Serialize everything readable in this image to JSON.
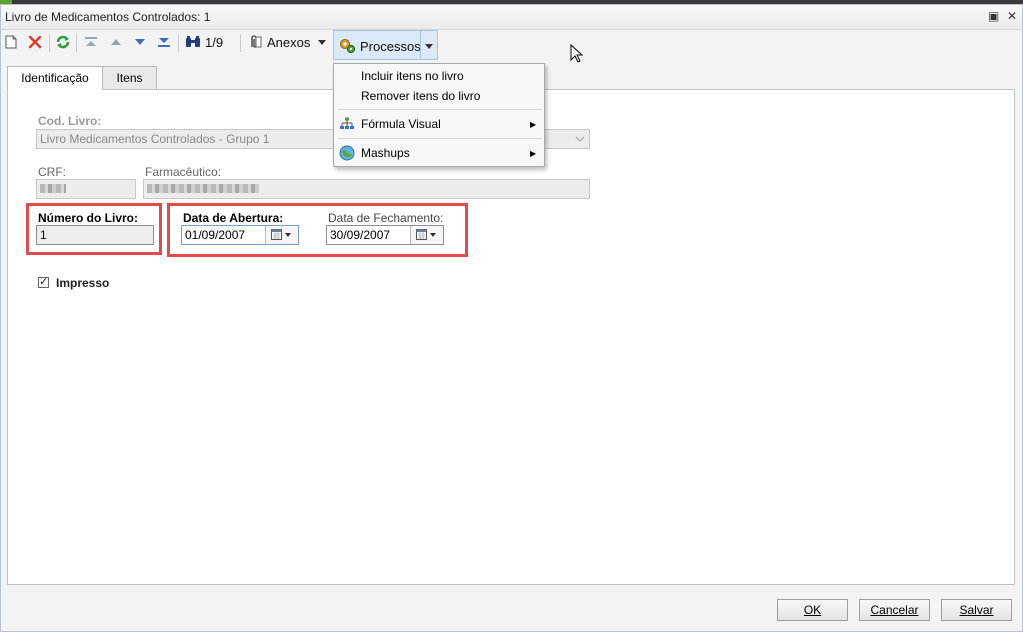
{
  "window": {
    "title": "Livro de Medicamentos Controlados: 1",
    "restore_glyph": "▣",
    "close_glyph": "✕"
  },
  "toolbar": {
    "record_counter": "1/9",
    "anexos_label": "Anexos",
    "processos_label": "Processos",
    "icons": [
      "new-icon",
      "delete-icon",
      "refresh-icon",
      "first-icon",
      "previous-icon",
      "next-icon",
      "last-icon",
      "search-icon",
      "paperclip-icon",
      "gears-icon"
    ]
  },
  "tabs": [
    {
      "label": "Identificação",
      "active": true
    },
    {
      "label": "Itens",
      "active": false
    }
  ],
  "form": {
    "cod_livro_label": "Cod. Livro:",
    "cod_livro_value": "Livro Medicamentos Controlados - Grupo 1",
    "crf_label": "CRF:",
    "farmaceutico_label": "Farmacêutico:",
    "numero_livro_label": "Número do Livro:",
    "numero_livro_value": "1",
    "data_abertura_label": "Data de Abertura:",
    "data_abertura_value": "01/09/2007",
    "data_fechamento_label": "Data de Fechamento:",
    "data_fechamento_value": "30/09/2007",
    "impresso_label": "Impresso",
    "impresso_checked": true,
    "check_glyph": "✓"
  },
  "processos_menu": {
    "items": [
      {
        "label": "Incluir itens no livro",
        "submenu": false
      },
      {
        "label": "Remover itens do livro",
        "submenu": false
      },
      {
        "label": "Fórmula Visual",
        "submenu": true
      },
      {
        "label": "Mashups",
        "submenu": true
      }
    ],
    "submenu_glyph": "▶"
  },
  "buttons": {
    "ok": "OK",
    "cancelar": "Cancelar",
    "salvar": "Salvar"
  },
  "colors": {
    "highlight_box": "#e34b4b",
    "delete_icon": "#e0392b",
    "refresh_icon": "#2f9e3a",
    "nav_arrows": "#3a6fc4"
  }
}
